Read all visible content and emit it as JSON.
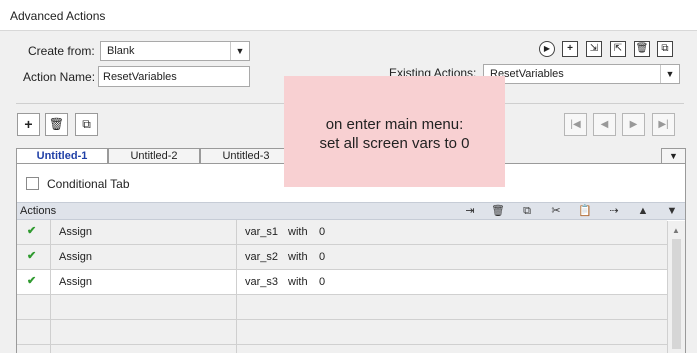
{
  "window": {
    "title": "Advanced Actions"
  },
  "form": {
    "create_from_label": "Create from:",
    "create_from_value": "Blank",
    "action_name_label": "Action Name:",
    "action_name_value": "ResetVariables",
    "existing_actions_label": "Existing Actions:",
    "existing_actions_value": "ResetVariables"
  },
  "tabs": [
    {
      "label": "Untitled-1",
      "active": true
    },
    {
      "label": "Untitled-2",
      "active": false
    },
    {
      "label": "Untitled-3",
      "active": false
    }
  ],
  "conditional_tab_label": "Conditional Tab",
  "actions_header": "Actions",
  "rows": [
    {
      "status": "✔",
      "action": "Assign",
      "target": "var_s1",
      "with_label": "with",
      "value": "0"
    },
    {
      "status": "✔",
      "action": "Assign",
      "target": "var_s2",
      "with_label": "with",
      "value": "0"
    },
    {
      "status": "✔",
      "action": "Assign",
      "target": "var_s3",
      "with_label": "with",
      "value": "0"
    }
  ],
  "note": {
    "line1": "on enter main menu:",
    "line2": "set all screen vars to 0",
    "color": "#f8d0d2"
  },
  "icons": {
    "top_toolbar": [
      "play-icon",
      "add-icon",
      "import-icon",
      "export-icon",
      "delete-icon",
      "duplicate-icon"
    ],
    "decision_toolbar": [
      "add-icon",
      "delete-icon",
      "duplicate-icon"
    ],
    "nav": [
      "first-icon",
      "previous-icon",
      "next-icon",
      "last-icon"
    ],
    "actions_toolbar": [
      "insert-icon",
      "delete-icon",
      "copy-icon",
      "cut-icon",
      "paste-icon",
      "insert-below-icon",
      "move-up-icon",
      "move-down-icon"
    ]
  }
}
